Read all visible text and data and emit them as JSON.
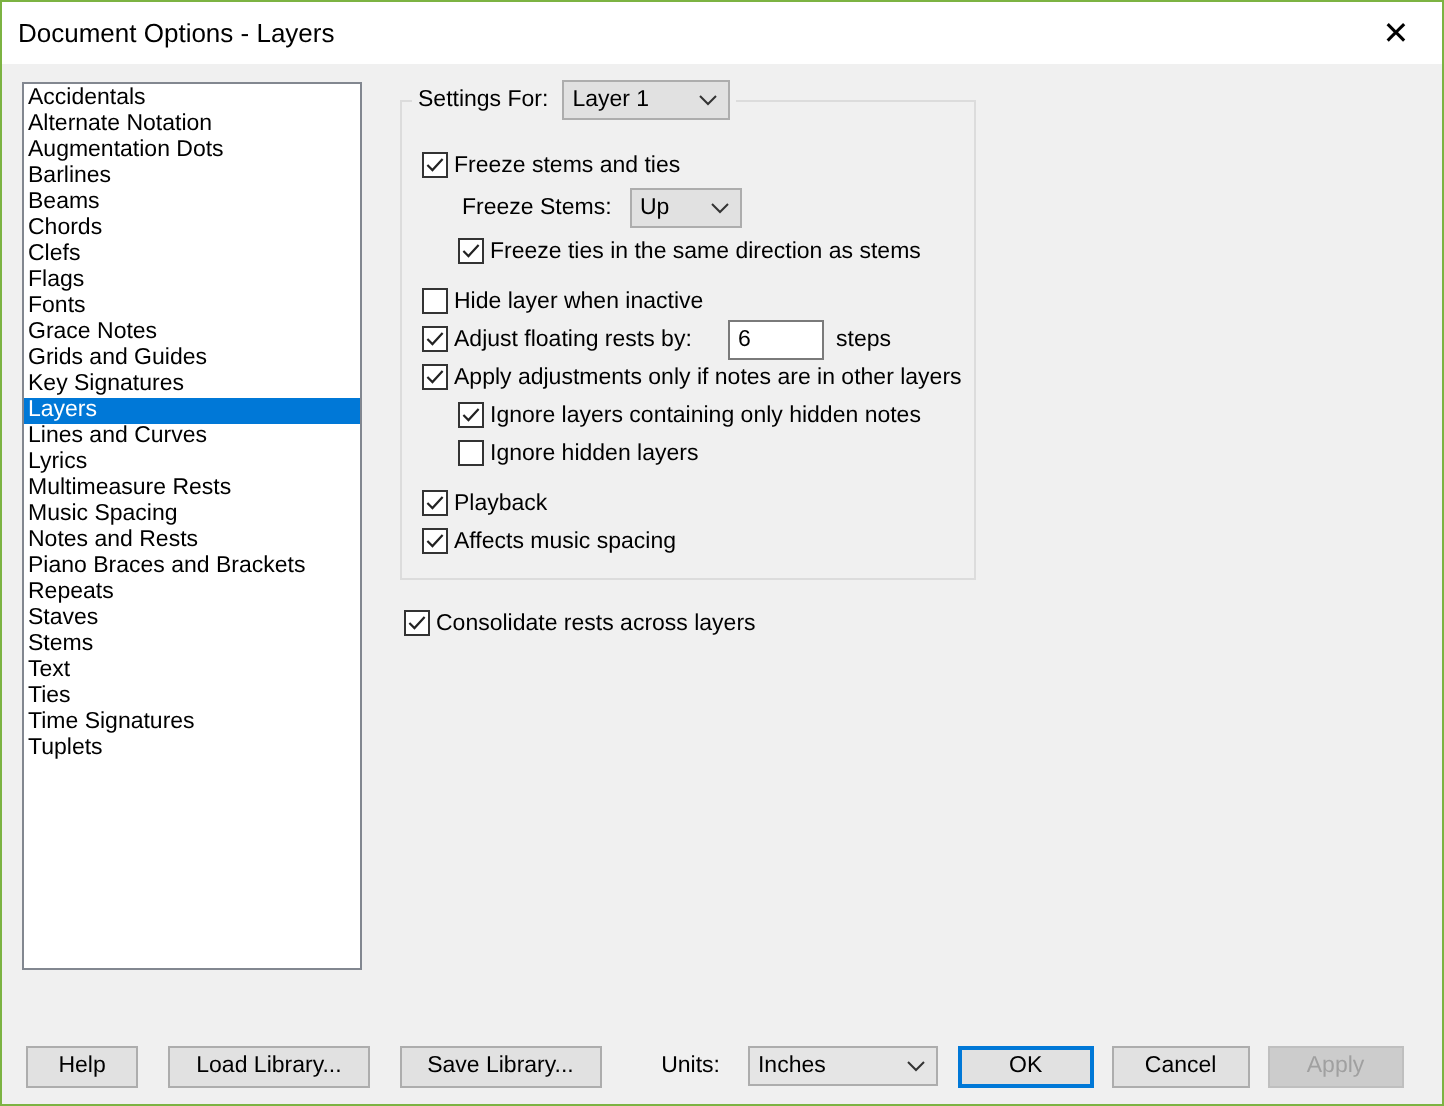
{
  "window": {
    "title": "Document Options - Layers",
    "close": "✕"
  },
  "sidebar": {
    "items": [
      {
        "label": "Accidentals",
        "selected": false
      },
      {
        "label": "Alternate Notation",
        "selected": false
      },
      {
        "label": "Augmentation Dots",
        "selected": false
      },
      {
        "label": "Barlines",
        "selected": false
      },
      {
        "label": "Beams",
        "selected": false
      },
      {
        "label": "Chords",
        "selected": false
      },
      {
        "label": "Clefs",
        "selected": false
      },
      {
        "label": "Flags",
        "selected": false
      },
      {
        "label": "Fonts",
        "selected": false
      },
      {
        "label": "Grace Notes",
        "selected": false
      },
      {
        "label": "Grids and Guides",
        "selected": false
      },
      {
        "label": "Key Signatures",
        "selected": false
      },
      {
        "label": "Layers",
        "selected": true
      },
      {
        "label": "Lines and Curves",
        "selected": false
      },
      {
        "label": "Lyrics",
        "selected": false
      },
      {
        "label": "Multimeasure Rests",
        "selected": false
      },
      {
        "label": "Music Spacing",
        "selected": false
      },
      {
        "label": "Notes and Rests",
        "selected": false
      },
      {
        "label": "Piano Braces and Brackets",
        "selected": false
      },
      {
        "label": "Repeats",
        "selected": false
      },
      {
        "label": "Staves",
        "selected": false
      },
      {
        "label": "Stems",
        "selected": false
      },
      {
        "label": "Text",
        "selected": false
      },
      {
        "label": "Ties",
        "selected": false
      },
      {
        "label": "Time Signatures",
        "selected": false
      },
      {
        "label": "Tuplets",
        "selected": false
      }
    ]
  },
  "settings": {
    "label": "Settings For:",
    "value": "Layer 1",
    "options": [
      {
        "kind": "checkbox",
        "label": "Freeze stems and ties",
        "checked": true,
        "children": [
          {
            "kind": "dropdown",
            "label": "Freeze Stems:",
            "value": "Up"
          },
          {
            "kind": "checkbox",
            "label": "Freeze ties in the same direction as stems",
            "checked": true
          }
        ]
      },
      {
        "kind": "checkbox",
        "label": "Hide layer when inactive",
        "checked": false
      },
      {
        "kind": "number",
        "label": "Adjust floating rests by:",
        "checked": true,
        "value": "6",
        "unit": "steps"
      },
      {
        "kind": "checkbox",
        "label": "Apply adjustments only if notes are in other layers",
        "checked": true,
        "children": [
          {
            "kind": "checkbox",
            "label": "Ignore layers containing only hidden notes",
            "checked": true
          },
          {
            "kind": "checkbox",
            "label": "Ignore hidden layers",
            "checked": false
          }
        ]
      },
      {
        "kind": "checkbox",
        "label": "Playback",
        "checked": true
      },
      {
        "kind": "checkbox",
        "label": "Affects music spacing",
        "checked": true
      }
    ]
  },
  "consolidate": {
    "label": "Consolidate rests across layers",
    "checked": true
  },
  "footer": {
    "left_buttons": [
      {
        "label": "Help",
        "default": false,
        "disabled": false
      },
      {
        "label": "Load Library...",
        "default": false,
        "disabled": false
      },
      {
        "label": "Save Library...",
        "default": false,
        "disabled": false
      }
    ],
    "units": {
      "label": "Units:",
      "value": "Inches"
    },
    "right_buttons": [
      {
        "label": "OK",
        "default": true,
        "disabled": false
      },
      {
        "label": "Cancel",
        "default": false,
        "disabled": false
      },
      {
        "label": "Apply",
        "default": false,
        "disabled": true
      }
    ]
  }
}
